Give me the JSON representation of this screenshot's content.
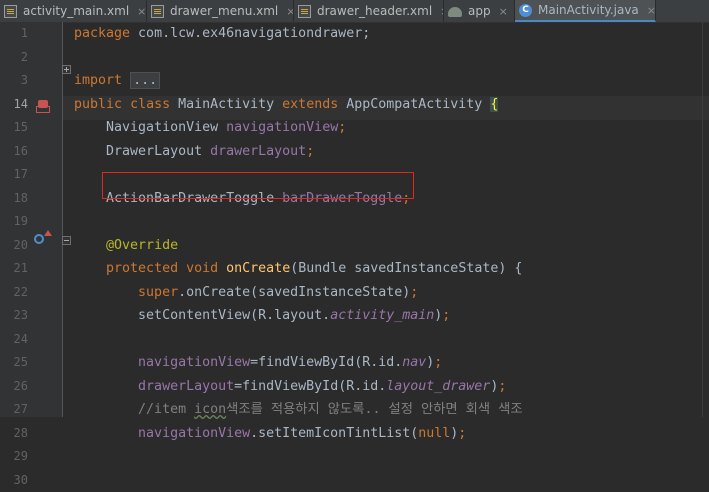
{
  "tabs": [
    {
      "label": "activity_main.xml",
      "icon": "xml-file-icon",
      "close": "×"
    },
    {
      "label": "drawer_menu.xml",
      "icon": "xml-file-icon",
      "close": "×"
    },
    {
      "label": "drawer_header.xml",
      "icon": "xml-file-icon",
      "close": "×"
    },
    {
      "label": "app",
      "icon": "android-module-icon",
      "close": "×"
    },
    {
      "label": "MainActivity.java",
      "icon": "java-class-icon",
      "icon_letter": "C",
      "close": "×",
      "active": true
    }
  ],
  "line_numbers": [
    "1",
    "2",
    "3",
    "14",
    "15",
    "16",
    "17",
    "18",
    "19",
    "20",
    "21",
    "22",
    "23",
    "24",
    "25",
    "26",
    "27",
    "28",
    "29",
    "30"
  ],
  "current_line": "14",
  "code": {
    "l1": {
      "kw": "package",
      "rest": " com.lcw.ex46navigationdrawer;"
    },
    "l3": {
      "kw": "import",
      "fold": "..."
    },
    "l14": {
      "kw1": "public",
      "kw2": "class",
      "name": " MainActivity ",
      "kw3": "extends",
      "parent": " AppCompatActivity ",
      "brace": "{"
    },
    "l15": {
      "type": "NavigationView ",
      "field": "navigationView",
      "semi": ";"
    },
    "l16": {
      "type": "DrawerLayout ",
      "field": "drawerLayout",
      "semi": ";"
    },
    "l18": {
      "type": "ActionBarDrawerToggle ",
      "field": "barDrawerToggle",
      "semi": ";"
    },
    "l20": {
      "annotation": "@Override"
    },
    "l21": {
      "kw1": "protected",
      "kw2": "void",
      "method": "onCreate",
      "params": "(Bundle savedInstanceState) {"
    },
    "l22": {
      "kw": "super",
      "rest": ".onCreate(savedInstanceState)",
      "semi": ";"
    },
    "l23": {
      "pre": "setContentView(R.layout.",
      "field": "activity_main",
      "post": ")",
      "semi": ";"
    },
    "l25": {
      "field": "navigationView",
      "pre": "=findViewById(R.id.",
      "field2": "nav",
      "post": ")",
      "semi": ";"
    },
    "l26": {
      "field": "drawerLayout",
      "pre": "=findViewById(R.id.",
      "field2": "layout_drawer",
      "post": ")",
      "semi": ";"
    },
    "l27": {
      "pre": "//item ",
      "squig": "icon",
      "post": "색조를 적용하지 않도록.. 설정 안하면 회색 색조"
    },
    "l28": {
      "field": "navigationView",
      "pre": ".setItemIconTintList(",
      "kw": "null",
      "post": ")",
      "semi": ";"
    }
  }
}
